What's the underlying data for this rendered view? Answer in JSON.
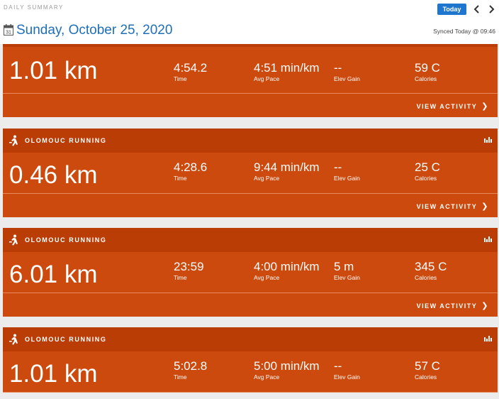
{
  "header": {
    "section_label": "DAILY SUMMARY",
    "date_title": "Sunday, October 25, 2020",
    "today_button": "Today",
    "synced_text": "Synced Today @ 09:46",
    "icons": {
      "calendar": "calendar-icon",
      "prev": "chevron-left-icon",
      "next": "chevron-right-icon"
    }
  },
  "labels": {
    "time": "Time",
    "pace": "Avg Pace",
    "elev": "Elev Gain",
    "calories": "Calories",
    "view": "VIEW ACTIVITY"
  },
  "activities": [
    {
      "title": "",
      "distance": "1.01 km",
      "time": "4:54.2",
      "pace": "4:51 min/km",
      "elev": "--",
      "calories": "59 C"
    },
    {
      "title": "OLOMOUC RUNNING",
      "distance": "0.46 km",
      "time": "4:28.6",
      "pace": "9:44 min/km",
      "elev": "--",
      "calories": "25 C"
    },
    {
      "title": "OLOMOUC RUNNING",
      "distance": "6.01 km",
      "time": "23:59",
      "pace": "4:00 min/km",
      "elev": "5 m",
      "calories": "345 C"
    },
    {
      "title": "OLOMOUC RUNNING",
      "distance": "1.01 km",
      "time": "5:02.8",
      "pace": "5:00 min/km",
      "elev": "--",
      "calories": "57 C"
    }
  ],
  "colors": {
    "accent": "#1e76cf",
    "card": "#cc4a0e",
    "card_header": "#ba3d06"
  }
}
